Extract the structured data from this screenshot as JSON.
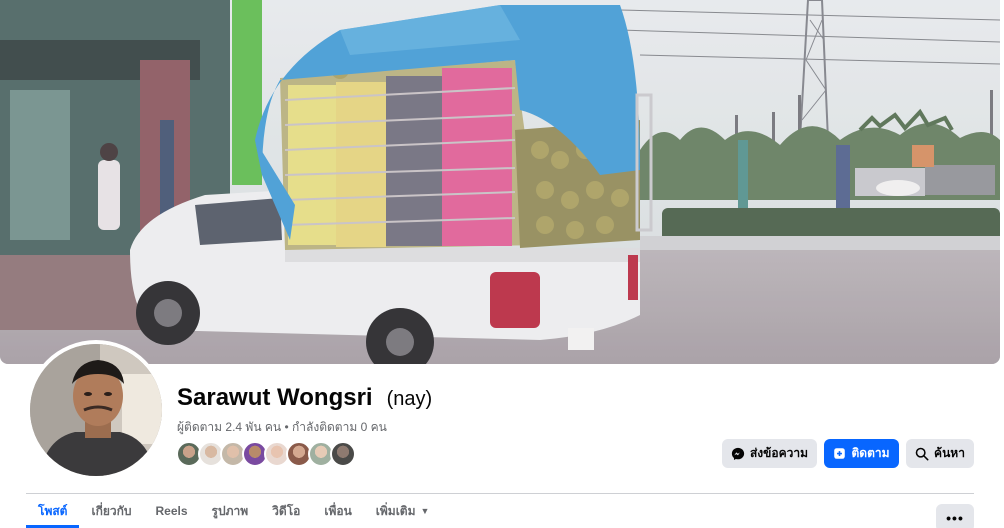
{
  "profile": {
    "name": "Sarawut Wongsri",
    "alternate_name": "(nay)",
    "followers_text": "ผู้ติดตาม 2.4 พัน คน",
    "separator": "•",
    "following_text": "กำลังติดตาม 0 คน"
  },
  "cover": {
    "description": "white pickup truck loaded with durian under blue tarp"
  },
  "actions": {
    "message_label": "ส่งข้อความ",
    "follow_label": "ติดตาม",
    "search_label": "ค้นหา"
  },
  "tabs": [
    {
      "label": "โพสต์",
      "active": true
    },
    {
      "label": "เกี่ยวกับ",
      "active": false
    },
    {
      "label": "Reels",
      "active": false
    },
    {
      "label": "รูปภาพ",
      "active": false
    },
    {
      "label": "วิดีโอ",
      "active": false
    },
    {
      "label": "เพื่อน",
      "active": false
    },
    {
      "label": "เพิ่มเติม",
      "active": false
    }
  ],
  "more_menu_label": "•••",
  "icons": {
    "messenger": "messenger-icon",
    "follow": "follow-icon",
    "search": "search-icon",
    "dropdown": "caret-down-icon"
  },
  "colors": {
    "accent": "#0866ff",
    "button_grey": "#e4e6eb",
    "muted_text": "#65676b"
  }
}
